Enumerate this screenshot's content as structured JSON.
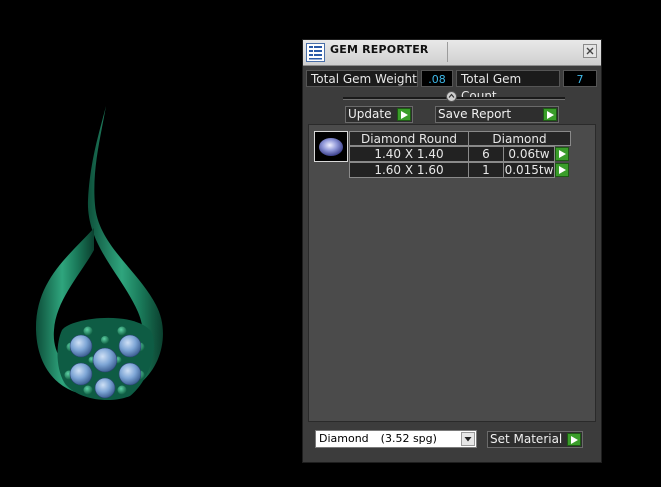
{
  "panel": {
    "title": "GEM REPORTER",
    "icons": {
      "app": "gem-reporter-icon",
      "close": "close-icon"
    }
  },
  "totals": {
    "weight_label": "Total Gem Weight",
    "weight_value": ".08",
    "count_label": "Total Gem Count",
    "count_value": "7"
  },
  "buttons": {
    "update": "Update",
    "save_report": "Save Report",
    "set_material": "Set Material"
  },
  "report": {
    "headers": [
      "Diamond Round",
      "Diamond"
    ],
    "rows": [
      {
        "size": "1.40 X 1.40",
        "count": "6",
        "weight": "0.06tw"
      },
      {
        "size": "1.60 X 1.60",
        "count": "1",
        "weight": "0.015tw"
      }
    ]
  },
  "material": {
    "selected": "Diamond",
    "spg": "(3.52 spg)"
  },
  "colors": {
    "accent_green": "#3a9d2a",
    "value_blue": "#3fb8e8",
    "jewelry_green": "#1f8a66",
    "gem_blue": "#7ea6d6"
  }
}
